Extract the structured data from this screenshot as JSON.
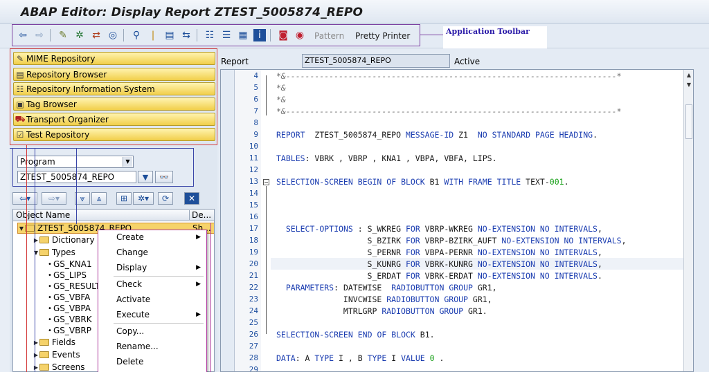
{
  "window": {
    "title": "ABAP Editor: Display Report ZTEST_5005874_REPO"
  },
  "toolbar": {
    "buttons": [
      "back-arrow-icon",
      "forward-arrow-icon",
      "display-change-icon",
      "other-object-icon",
      "active-inactive-icon",
      "syntax-check-icon",
      "activate-icon",
      "test-icon",
      "where-used-icon",
      "enhancement-icon",
      "object-list-icon",
      "navigation-window-icon",
      "display-object-list-icon",
      "info-icon",
      "breakpoint-icon",
      "external-breakpoint-icon"
    ],
    "pattern_label": "Pattern",
    "pretty_printer_label": "Pretty Printer",
    "annotation": "Application Toolbar"
  },
  "navigator": {
    "buttons": [
      {
        "label": "MIME Repository",
        "icon": "mime-icon"
      },
      {
        "label": "Repository Browser",
        "icon": "browser-icon"
      },
      {
        "label": "Repository Information System",
        "icon": "info-system-icon"
      },
      {
        "label": "Tag Browser",
        "icon": "tag-icon"
      },
      {
        "label": "Transport Organizer",
        "icon": "truck-icon"
      },
      {
        "label": "Test Repository",
        "icon": "test-icon"
      }
    ],
    "object_type": "Program",
    "object_name": "ZTEST_5005874_REPO",
    "tree_headers": [
      "Object Name",
      "De..."
    ],
    "tree": [
      {
        "label": "ZTEST_5005874_REPO",
        "extra": "Sh..."
      },
      {
        "label": "Dictionary S"
      },
      {
        "label": "Types"
      },
      {
        "label": "GS_KNA1"
      },
      {
        "label": "GS_LIPS"
      },
      {
        "label": "GS_RESULT"
      },
      {
        "label": "GS_VBFA"
      },
      {
        "label": "GS_VBPA"
      },
      {
        "label": "GS_VBRK"
      },
      {
        "label": "GS_VBRP"
      },
      {
        "label": "Fields"
      },
      {
        "label": "Events"
      },
      {
        "label": "Screens"
      }
    ]
  },
  "context_menu": {
    "items": [
      {
        "label": "Create",
        "submenu": "▶"
      },
      {
        "label": "Change",
        "submenu": ""
      },
      {
        "label": "Display",
        "submenu": "▶"
      },
      {
        "label": "Check",
        "submenu": "▶"
      },
      {
        "label": "Activate",
        "submenu": ""
      },
      {
        "label": "Execute",
        "submenu": "▶"
      },
      {
        "label": "Copy...",
        "submenu": ""
      },
      {
        "label": "Rename...",
        "submenu": ""
      },
      {
        "label": "Delete",
        "submenu": ""
      }
    ]
  },
  "report": {
    "label": "Report",
    "name": "ZTEST_5005874_REPO",
    "status": "Active"
  },
  "editor": {
    "lines": [
      {
        "n": "4",
        "text": "*&---------------------------------------------------------------------*"
      },
      {
        "n": "5",
        "text": "*&"
      },
      {
        "n": "6",
        "text": "*&"
      },
      {
        "n": "7",
        "text": "*&---------------------------------------------------------------------*"
      },
      {
        "n": "8",
        "text": ""
      },
      {
        "n": "9",
        "text": "REPORT  ZTEST_5005874_REPO MESSAGE-ID Z1  NO STANDARD PAGE HEADING."
      },
      {
        "n": "10",
        "text": ""
      },
      {
        "n": "11",
        "text": "TABLES: VBRK , VBRP , KNA1 , VBPA, VBFA, LIPS."
      },
      {
        "n": "12",
        "text": ""
      },
      {
        "n": "13",
        "text": "SELECTION-SCREEN BEGIN OF BLOCK B1 WITH FRAME TITLE TEXT-001."
      },
      {
        "n": "14",
        "text": ""
      },
      {
        "n": "15",
        "text": ""
      },
      {
        "n": "16",
        "text": ""
      },
      {
        "n": "17",
        "text": "  SELECT-OPTIONS : S_WKREG FOR VBRP-WKREG NO-EXTENSION NO INTERVALS,"
      },
      {
        "n": "18",
        "text": "                   S_BZIRK FOR VBRP-BZIRK_AUFT NO-EXTENSION NO INTERVALS,"
      },
      {
        "n": "19",
        "text": "                   S_PERNR FOR VBPA-PERNR NO-EXTENSION NO INTERVALS,"
      },
      {
        "n": "20",
        "text": "                   S_KUNRG FOR VBRK-KUNRG NO-EXTENSION NO INTERVALS,"
      },
      {
        "n": "21",
        "text": "                   S_ERDAT FOR VBRK-ERDAT NO-EXTENSION NO INTERVALS."
      },
      {
        "n": "22",
        "text": "  PARAMETERS: DATEWISE  RADIOBUTTON GROUP GR1,"
      },
      {
        "n": "23",
        "text": "              INVCWISE RADIOBUTTON GROUP GR1,"
      },
      {
        "n": "24",
        "text": "              MTRLGRP RADIOBUTTON GROUP GR1."
      },
      {
        "n": "25",
        "text": ""
      },
      {
        "n": "26",
        "text": "SELECTION-SCREEN END OF BLOCK B1."
      },
      {
        "n": "27",
        "text": ""
      },
      {
        "n": "28",
        "text": "DATA: A TYPE I , B TYPE I VALUE 0 ."
      },
      {
        "n": "29",
        "text": ""
      }
    ]
  }
}
